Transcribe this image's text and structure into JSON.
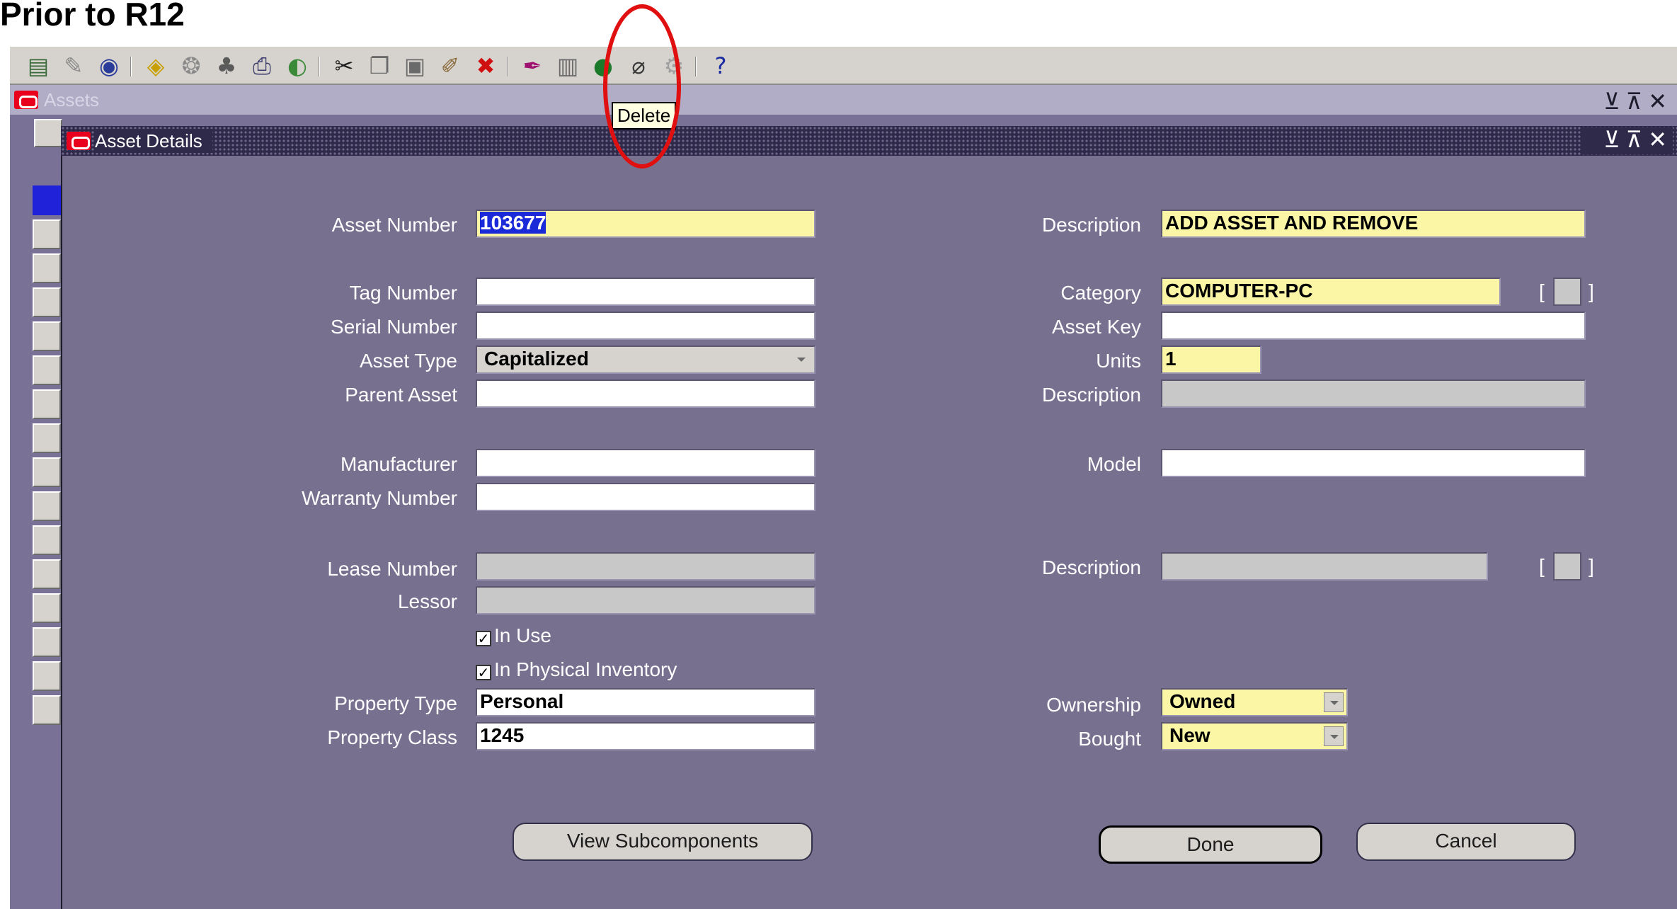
{
  "heading": "Prior to R12",
  "toolbar": {
    "icons": [
      "new-icon",
      "find-icon",
      "navigator-icon",
      "save-icon",
      "next-step-icon",
      "switch-responsibility-icon",
      "print-icon",
      "close-form-icon",
      "cut-icon",
      "copy-icon",
      "paste-icon",
      "clear-record-icon",
      "delete-icon",
      "edit-field-icon",
      "zoom-icon",
      "translations-icon",
      "attachments-icon",
      "folder-tools-icon",
      "help-icon"
    ],
    "tooltip": "Delete"
  },
  "outer_window": {
    "title": "Assets"
  },
  "inner_window": {
    "title": "Asset Details"
  },
  "form": {
    "asset_number": {
      "label": "Asset Number",
      "value": "103677"
    },
    "description": {
      "label": "Description",
      "value": "ADD ASSET AND REMOVE"
    },
    "tag_number": {
      "label": "Tag Number",
      "value": ""
    },
    "category": {
      "label": "Category",
      "value": "COMPUTER-PC",
      "bracket_open": "[",
      "bracket_close": "]"
    },
    "serial_number": {
      "label": "Serial Number",
      "value": ""
    },
    "asset_key": {
      "label": "Asset Key",
      "value": ""
    },
    "asset_type": {
      "label": "Asset Type",
      "value": "Capitalized"
    },
    "units": {
      "label": "Units",
      "value": "1"
    },
    "parent_asset": {
      "label": "Parent Asset",
      "value": ""
    },
    "parent_description": {
      "label": "Description",
      "value": ""
    },
    "manufacturer": {
      "label": "Manufacturer",
      "value": ""
    },
    "model": {
      "label": "Model",
      "value": ""
    },
    "warranty_number": {
      "label": "Warranty Number",
      "value": ""
    },
    "lease_number": {
      "label": "Lease Number",
      "value": ""
    },
    "lease_description": {
      "label": "Description",
      "value": "",
      "bracket_open": "[",
      "bracket_close": "]"
    },
    "lessor": {
      "label": "Lessor",
      "value": ""
    },
    "in_use": {
      "label": "In Use",
      "checked": true
    },
    "in_physical_inventory": {
      "label": "In Physical Inventory",
      "checked": true
    },
    "property_type": {
      "label": "Property Type",
      "value": "Personal"
    },
    "ownership": {
      "label": "Ownership",
      "value": "Owned"
    },
    "property_class": {
      "label": "Property Class",
      "value": "1245"
    },
    "bought": {
      "label": "Bought",
      "value": "New"
    }
  },
  "buttons": {
    "view_subcomponents": "View Subcomponents",
    "done": "Done",
    "cancel": "Cancel"
  },
  "colors": {
    "form_background": "#78708f",
    "required_field": "#fbf6a6",
    "annotation": "#e01010"
  }
}
